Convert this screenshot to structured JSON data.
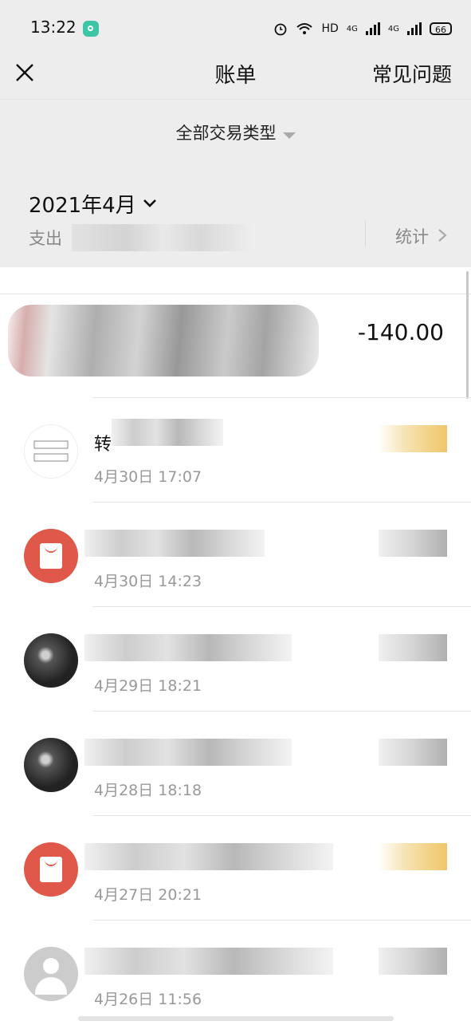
{
  "status_bar": {
    "time": "13:22",
    "network": "HD",
    "sim1": "4G",
    "sim2": "4G",
    "battery": "66"
  },
  "header": {
    "title": "账单",
    "faq_label": "常见问题"
  },
  "filter": {
    "label": "全部交易类型"
  },
  "month_section": {
    "month": "2021年4月",
    "spend_label": "支出",
    "stats_label": "统计"
  },
  "transactions": [
    {
      "amount": "-140.00"
    },
    {
      "title": "转",
      "time": "4月30日 17:07",
      "avatar": "qr-avatar"
    },
    {
      "time": "4月30日 14:23",
      "avatar": "red-envelope-icon"
    },
    {
      "time": "4月29日 18:21",
      "avatar": "photo-avatar"
    },
    {
      "time": "4月28日 18:18",
      "avatar": "photo-avatar"
    },
    {
      "time": "4月27日 20:21",
      "avatar": "red-envelope-icon"
    },
    {
      "time": "4月26日 11:56",
      "avatar": "person-icon"
    }
  ],
  "colors": {
    "background": "#ededed",
    "red_envelope": "#e0584a",
    "secondary_text": "#999999"
  }
}
